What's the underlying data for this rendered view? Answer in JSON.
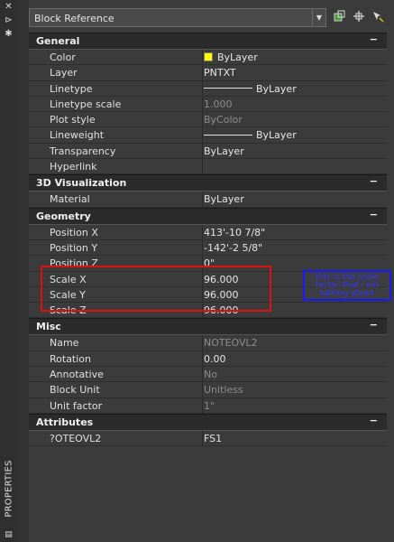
{
  "sidebar": {
    "icons": [
      "close-icon",
      "pin-icon",
      "settings-icon",
      "properties-small-icon"
    ],
    "label": "PROPERTIES"
  },
  "header": {
    "selection": "Block Reference",
    "tools": [
      "toggle-pickadd-icon",
      "select-objects-icon",
      "quick-select-icon"
    ]
  },
  "sections": [
    {
      "title": "General",
      "collapse": "−",
      "rows": [
        {
          "name": "Color",
          "value": "ByLayer",
          "swatch": "#ffff00"
        },
        {
          "name": "Layer",
          "value": "PNTXT"
        },
        {
          "name": "Linetype",
          "value": "ByLayer",
          "line": true
        },
        {
          "name": "Linetype scale",
          "value": "1.000",
          "dim": true
        },
        {
          "name": "Plot style",
          "value": "ByColor",
          "dim": true
        },
        {
          "name": "Lineweight",
          "value": "ByLayer",
          "line": true
        },
        {
          "name": "Transparency",
          "value": "ByLayer"
        },
        {
          "name": "Hyperlink",
          "value": ""
        }
      ]
    },
    {
      "title": "3D Visualization",
      "collapse": "−",
      "rows": [
        {
          "name": "Material",
          "value": "ByLayer"
        }
      ]
    },
    {
      "title": "Geometry",
      "collapse": "−",
      "rows": [
        {
          "name": "Position X",
          "value": "413'-10 7/8\""
        },
        {
          "name": "Position Y",
          "value": "-142'-2 5/8\""
        },
        {
          "name": "Position Z",
          "value": "0\""
        },
        {
          "name": "Scale X",
          "value": "96.000"
        },
        {
          "name": "Scale Y",
          "value": "96.000"
        },
        {
          "name": "Scale Z",
          "value": "96.000"
        }
      ]
    },
    {
      "title": "Misc",
      "collapse": "−",
      "rows": [
        {
          "name": "Name",
          "value": "NOTEOVL2",
          "dim": true
        },
        {
          "name": "Rotation",
          "value": "0.00"
        },
        {
          "name": "Annotative",
          "value": "No",
          "dim": true
        },
        {
          "name": "Block Unit",
          "value": "Unitless",
          "dim": true
        },
        {
          "name": "Unit factor",
          "value": "1\"",
          "dim": true
        }
      ]
    },
    {
      "title": "Attributes",
      "collapse": "−",
      "rows": [
        {
          "name": "?OTEOVL2",
          "value": "FS1"
        }
      ]
    }
  ],
  "annotation": {
    "text": "this is the scale factor that i am talking about",
    "highlight_color": "#e01010",
    "note_color": "#1a1aff"
  }
}
